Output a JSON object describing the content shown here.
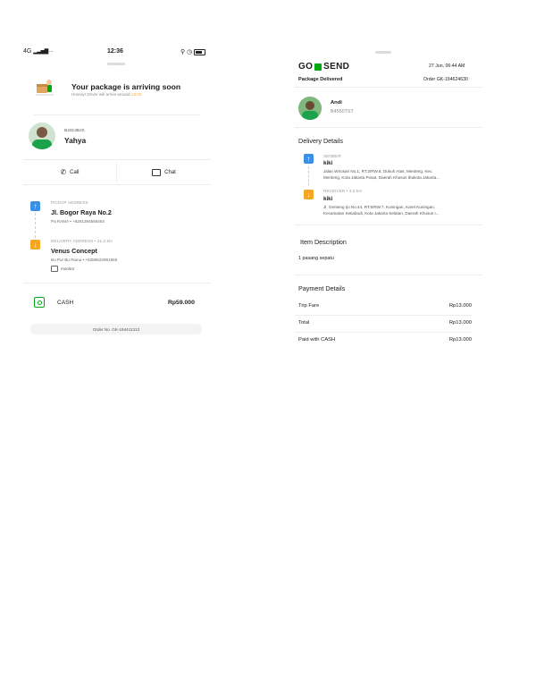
{
  "left": {
    "status_bar": {
      "network": "4G",
      "time": "12:36"
    },
    "arrival": {
      "title": "Your package is arriving soon",
      "subtitle_prefix": "Hooray! Driver will arrive around",
      "eta": "13:40"
    },
    "driver": {
      "plate": "B4313BJX",
      "name": "Yahya"
    },
    "actions": {
      "call_label": "Call",
      "chat_label": "Chat"
    },
    "pickup": {
      "label": "PICKUP ADDRESS",
      "address": "Jl. Bogor Raya No.2",
      "contact": "Pa RAMA • +6281394556454"
    },
    "delivery": {
      "label": "DELIVERY ADDRESS • 21.2 km",
      "address": "Venus Concept",
      "contact": "Bu Pur Bu Riana • +6289622981855",
      "item": "monitor"
    },
    "payment": {
      "method": "CASH",
      "amount": "Rp59.000"
    },
    "order_no": "Order No. GK-194411313"
  },
  "right": {
    "brand": {
      "left": "GO",
      "right": "SEND"
    },
    "date": "27 Jun, 06:44 AM",
    "status": "Package Delivered",
    "order": "Order GK-194624630",
    "driver": {
      "name": "Andi",
      "plate": "B4550TST"
    },
    "delivery_details": {
      "heading": "Delivery Details",
      "sender_label": "SENDER",
      "sender_name": "kiki",
      "sender_address_1": "Jalan Wirosari No.1, RT.2/RW.6, Dukuh Atas, Menteng, Kec.",
      "sender_address_2": "Menteng, Kota Jakarta Pusat, Daerah Khusus Ibukota Jakarta...",
      "receiver_label": "RECEIVER • 4.3 km",
      "receiver_name": "kiki",
      "receiver_address_1": "Jl. Genteng Ijo No.44, RT.6/RW.7, Kuningan, Karet Kuningan,",
      "receiver_address_2": "Kecamatan Setiabudi, Kota Jakarta Selatan, Daerah Khusus I..."
    },
    "item_description": {
      "heading": "Item Description",
      "text": "1 pasang sepatu"
    },
    "payment_details": {
      "heading": "Payment Details",
      "rows": [
        {
          "label": "Trip Fare",
          "value": "Rp13.000"
        },
        {
          "label": "Total",
          "value": "Rp13.000"
        },
        {
          "label": "Paid with CASH",
          "value": "Rp13.000"
        }
      ]
    }
  },
  "colors": {
    "accent_green": "#00aa13",
    "accent_blue": "#3a8fe6",
    "accent_orange": "#f5a623"
  }
}
